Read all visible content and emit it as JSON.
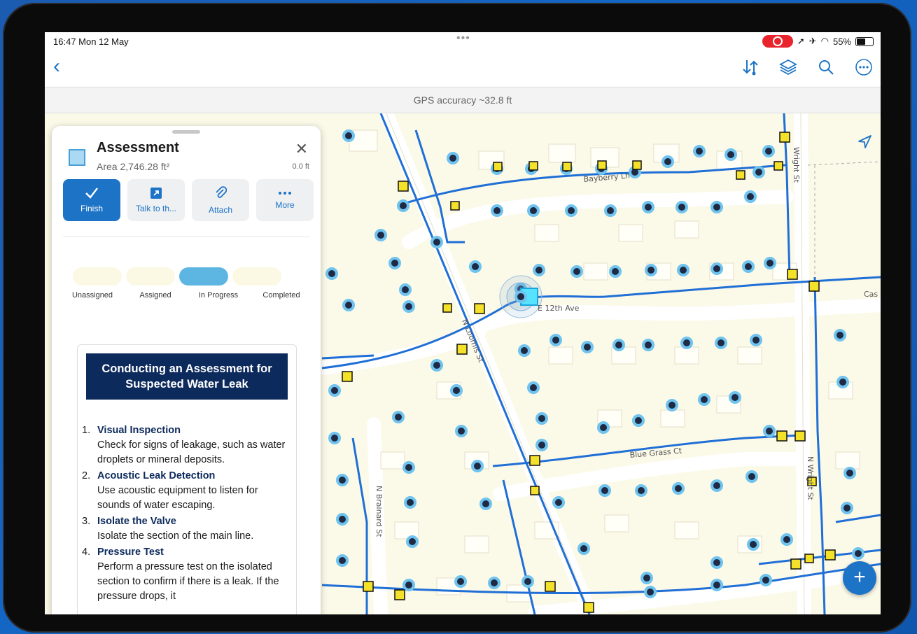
{
  "status_bar": {
    "time": "16:47  Mon 12 May",
    "battery": "55%"
  },
  "gps_accuracy": "GPS accuracy ~32.8 ft",
  "feature": {
    "title": "Assessment",
    "area": "Area 2,746.28 ft²",
    "distance": "0.0 ft"
  },
  "actions": [
    {
      "label": "Finish",
      "icon": "checkmark-icon"
    },
    {
      "label": "Talk to th...",
      "icon": "open-external-icon"
    },
    {
      "label": "Attach",
      "icon": "paperclip-icon"
    },
    {
      "label": "More",
      "icon": "more-icon"
    }
  ],
  "status_steps": [
    {
      "label": "Unassigned",
      "active": false
    },
    {
      "label": "Assigned",
      "active": false
    },
    {
      "label": "In Progress",
      "active": true
    },
    {
      "label": "Completed",
      "active": false
    }
  ],
  "instructions": {
    "title": "Conducting an Assessment for Suspected Water Leak",
    "items": [
      {
        "num": "1.",
        "heading": "Visual Inspection",
        "text": "Check for signs of leakage, such as water droplets or mineral deposits."
      },
      {
        "num": "2.",
        "heading": "Acoustic Leak Detection",
        "text": "Use acoustic equipment to listen for sounds of water escaping."
      },
      {
        "num": "3.",
        "heading": "Isolate the Valve",
        "text": "Isolate the section of the main line."
      },
      {
        "num": "4.",
        "heading": "Pressure Test",
        "text": "Perform a pressure test on the isolated section to confirm if there is a leak. If the pressure drops, it"
      }
    ]
  },
  "map_labels": [
    "Bayberry Ln",
    "E 12th Ave",
    "N Loomis St",
    "Blue Grass Ct",
    "N Brainard St",
    "N Wright St",
    "Wright St",
    "Cas"
  ],
  "colors": {
    "accent": "#1d73c5",
    "pipe": "#1f6fd6",
    "header": "#0d2a5c",
    "progress": "#5db6e2"
  }
}
